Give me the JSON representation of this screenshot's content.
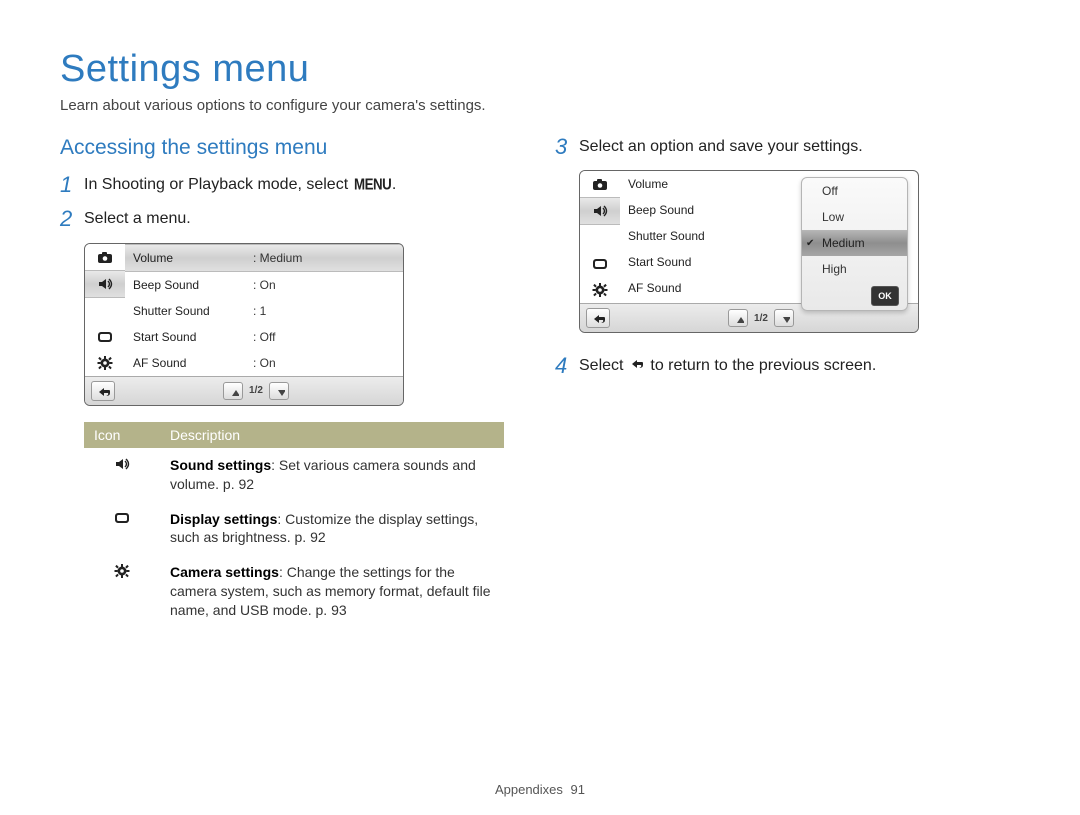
{
  "title": "Settings menu",
  "intro": "Learn about various options to configure your camera's settings.",
  "subhead": "Accessing the settings menu",
  "steps": {
    "s1_a": "In Shooting or Playback mode, select ",
    "s1_menu": "MENU",
    "s1_b": ".",
    "s2": "Select a menu.",
    "s3": "Select an option and save your settings.",
    "s4_a": "Select ",
    "s4_b": " to return to the previous screen."
  },
  "screen1": {
    "rows": [
      {
        "label": "Volume",
        "value": ": Medium"
      },
      {
        "label": "Beep Sound",
        "value": ": On"
      },
      {
        "label": "Shutter Sound",
        "value": ": 1"
      },
      {
        "label": "Start Sound",
        "value": ": Off"
      },
      {
        "label": "AF Sound",
        "value": ": On"
      }
    ],
    "page": "1/2"
  },
  "screen2": {
    "rows": [
      {
        "label": "Volume"
      },
      {
        "label": "Beep Sound"
      },
      {
        "label": "Shutter Sound"
      },
      {
        "label": "Start Sound"
      },
      {
        "label": "AF Sound"
      }
    ],
    "options": [
      {
        "label": "Off"
      },
      {
        "label": "Low"
      },
      {
        "label": "Medium",
        "selected": true
      },
      {
        "label": "High"
      }
    ],
    "ok": "OK",
    "page": "1/2"
  },
  "icontable": {
    "head_icon": "Icon",
    "head_desc": "Description",
    "rows": [
      {
        "icon": "sound-icon",
        "bold": "Sound settings",
        "text": ": Set various camera sounds and volume. p. 92"
      },
      {
        "icon": "display-icon",
        "bold": "Display settings",
        "text": ": Customize the display settings, such as brightness. p. 92"
      },
      {
        "icon": "gear-icon",
        "bold": "Camera settings",
        "text": ": Change the settings for the camera system, such as memory format, default file name, and USB mode. p. 93"
      }
    ]
  },
  "footer": {
    "label": "Appendixes",
    "page": "91"
  }
}
